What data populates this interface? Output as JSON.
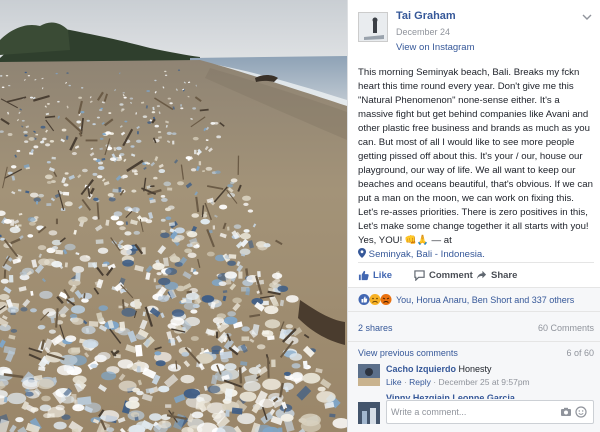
{
  "post": {
    "author": "Tai Graham",
    "date": "December 24",
    "via": "View on Instagram",
    "body": "This morning Seminyak beach, Bali. Breaks my fckn heart this time round every year. Don't give me this \"Natural Phenomenon\" none-sense either. It's a massive fight but get behind companies like Avani and other plastic free business and brands as much as you can. But most of all I would like to see more people getting pissed off about this. It's your / our, house our playground, our way of life. We all want to keep our beaches and oceans beautiful, that's obvious. If we can put a man on the moon, we can work on fixing this. Let's re-asses priorities. There is zero positives in this, Let's make some change together it all starts with you! Yes, YOU! 👊🙏 — at",
    "location": "Seminyak, Bali - Indonesia."
  },
  "actions": {
    "like": "Like",
    "comment": "Comment",
    "share": "Share"
  },
  "reactions": {
    "likers": "You, Horua Anaru, Ben Short and 337 others"
  },
  "stats": {
    "shares": "2 shares",
    "comments": "60 Comments"
  },
  "comments": {
    "view_previous": "View previous comments",
    "count": "6 of 60",
    "items": [
      {
        "name": "Cacho Izquierdo",
        "text": "Honesty",
        "like": "Like",
        "reply": "Reply",
        "time": "December 25 at 9:57pm"
      },
      {
        "name": "Vinny Hezgiajn Leonne Garcia"
      }
    ],
    "write_placeholder": "Write a comment..."
  },
  "colors": {
    "link": "#365899",
    "meta": "#90949c",
    "like_blue": "#4267b2",
    "sand": "#b8a58a",
    "sea": "#9fb2c6"
  }
}
